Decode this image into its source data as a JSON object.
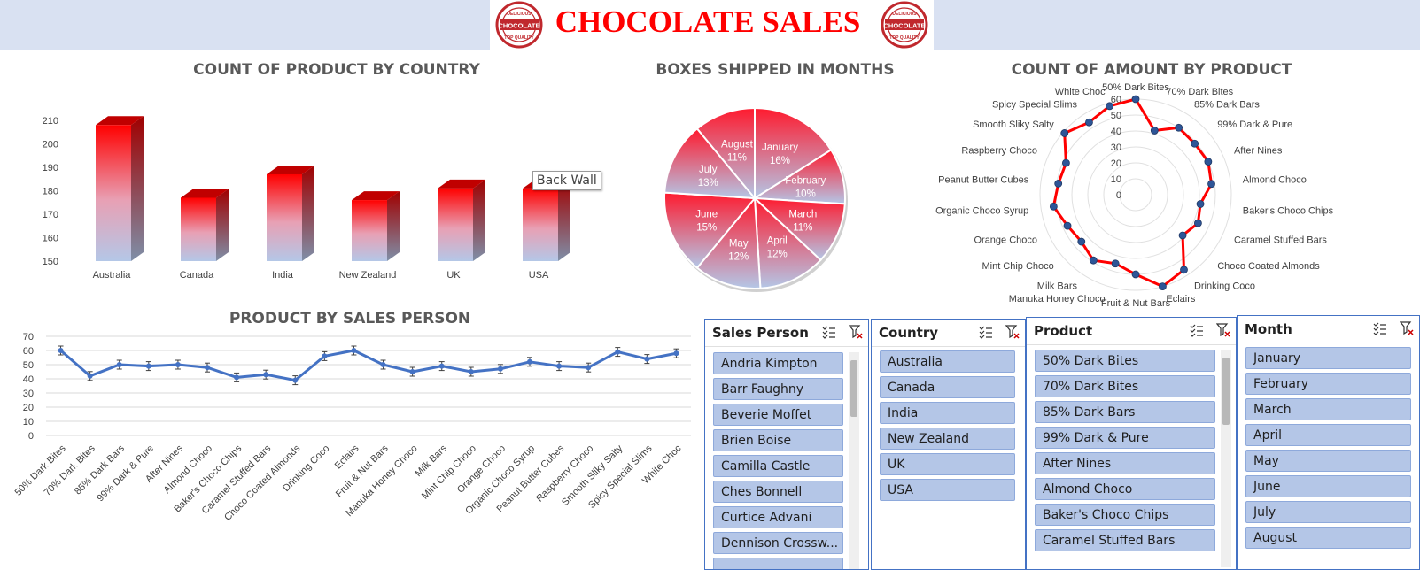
{
  "header": {
    "title": "CHOCOLATE SALES",
    "badge_top": "DELICIOUS",
    "badge_main": "CHOCOLATE",
    "badge_bottom": "TOP QUALITY",
    "bg_color": "#d9e1f2",
    "title_color": "#ff0000"
  },
  "bar_chart": {
    "title": "COUNT OF PRODUCT BY COUNTRY",
    "tooltip": "Back Wall"
  },
  "pie_chart": {
    "title": "BOXES SHIPPED IN MONTHS"
  },
  "radar_chart": {
    "title": "COUNT OF AMOUNT BY PRODUCT"
  },
  "line_chart": {
    "title": "PRODUCT BY SALES PERSON"
  },
  "chart_data": [
    {
      "type": "bar",
      "title": "COUNT OF PRODUCT BY COUNTRY",
      "categories": [
        "Australia",
        "Canada",
        "India",
        "New Zealand",
        "UK",
        "USA"
      ],
      "values": [
        208,
        177,
        187,
        176,
        181,
        181
      ],
      "ylim": [
        150,
        210
      ],
      "yticks": [
        150,
        160,
        170,
        180,
        190,
        200,
        210
      ],
      "grid": false,
      "gradient": [
        "#ff0000",
        "#b4c7e7"
      ]
    },
    {
      "type": "pie",
      "title": "BOXES SHIPPED IN MONTHS",
      "labels": [
        "January",
        "February",
        "March",
        "April",
        "May",
        "June",
        "July",
        "August"
      ],
      "values": [
        16,
        10,
        11,
        12,
        12,
        15,
        13,
        11
      ],
      "value_labels": [
        "16%",
        "10%",
        "11%",
        "12%",
        "12%",
        "15%",
        "13%",
        "11%"
      ]
    },
    {
      "type": "radar",
      "title": "COUNT OF AMOUNT BY PRODUCT",
      "categories": [
        "50% Dark Bites",
        "70% Dark Bites",
        "85% Dark Bars",
        "99% Dark & Pure",
        "After Nines",
        "Almond Choco",
        "Baker's Choco Chips",
        "Caramel Stuffed Bars",
        "Choco Coated Almonds",
        "Drinking Coco",
        "Eclairs",
        "Fruit & Nut Bars",
        "Manuka Honey Choco",
        "Milk Bars",
        "Mint Chip Choco",
        "Orange Choco",
        "Organic Choco Syrup",
        "Peanut Butter Cubes",
        "Raspberry Choco",
        "Smooth Sliky Salty",
        "Spicy Special Slims",
        "White Choc"
      ],
      "values": [
        60,
        42,
        50,
        49,
        50,
        48,
        41,
        43,
        39,
        56,
        60,
        50,
        45,
        49,
        45,
        47,
        52,
        49,
        48,
        59,
        54,
        58
      ],
      "rticks": [
        0,
        10,
        20,
        30,
        40,
        50,
        60
      ],
      "rmax": 60,
      "line_color": "#ff0000",
      "marker_color": "#2e5597"
    },
    {
      "type": "line",
      "title": "PRODUCT BY SALES PERSON",
      "categories": [
        "50% Dark Bites",
        "70% Dark Bites",
        "85% Dark Bars",
        "99% Dark & Pure",
        "After Nines",
        "Almond Choco",
        "Baker's Choco Chips",
        "Caramel Stuffed Bars",
        "Choco Coated Almonds",
        "Drinking Coco",
        "Eclairs",
        "Fruit & Nut Bars",
        "Manuka Honey Choco",
        "Milk Bars",
        "Mint Chip Choco",
        "Orange Choco",
        "Organic Choco Syrup",
        "Peanut Butter Cubes",
        "Raspberry Choco",
        "Smooth Sliky Salty",
        "Spicy Special Slims",
        "White Choc"
      ],
      "values": [
        60,
        42,
        50,
        49,
        50,
        48,
        41,
        43,
        39,
        56,
        60,
        50,
        45,
        49,
        45,
        47,
        52,
        49,
        48,
        59,
        54,
        58
      ],
      "ylim": [
        0,
        70
      ],
      "yticks": [
        0,
        10,
        20,
        30,
        40,
        50,
        60,
        70
      ],
      "grid": true,
      "line_color": "#4472c4"
    }
  ],
  "slicers": [
    {
      "title": "Sales Person",
      "items": [
        "Andria Kimpton",
        "Barr Faughny",
        "Beverie Moffet",
        "Brien Boise",
        "Camilla Castle",
        "Ches Bonnell",
        "Curtice Advani",
        "Dennison Crossw..."
      ]
    },
    {
      "title": "Country",
      "items": [
        "Australia",
        "Canada",
        "India",
        "New Zealand",
        "UK",
        "USA"
      ]
    },
    {
      "title": "Product",
      "items": [
        "50% Dark Bites",
        "70% Dark Bites",
        "85% Dark Bars",
        "99% Dark & Pure",
        "After Nines",
        "Almond Choco",
        "Baker's Choco Chips",
        "Caramel Stuffed Bars"
      ]
    },
    {
      "title": "Month",
      "items": [
        "January",
        "February",
        "March",
        "April",
        "May",
        "June",
        "July",
        "August"
      ]
    }
  ]
}
